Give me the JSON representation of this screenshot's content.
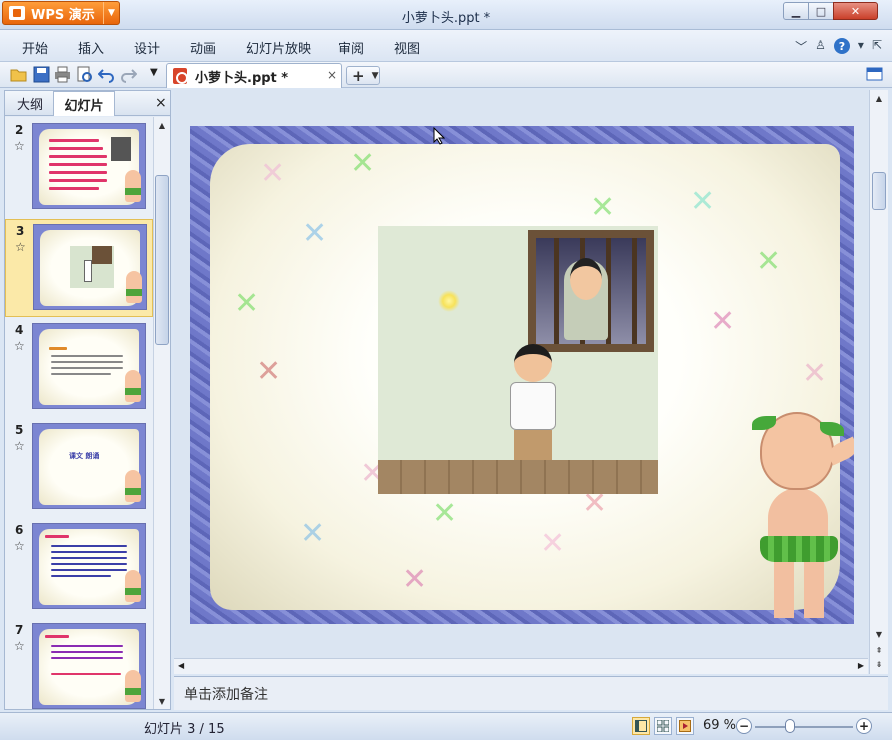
{
  "app": {
    "name": "WPS 演示",
    "title": "小萝卜头.ppt *"
  },
  "window": {
    "min": "▁",
    "max": "□",
    "close": "✕"
  },
  "menu": [
    "开始",
    "插入",
    "设计",
    "动画",
    "幻灯片放映",
    "审阅",
    "视图"
  ],
  "menu_right": {
    "collapse": "﹀",
    "help": "?"
  },
  "toolbar": {
    "doc_tab": "小萝卜头.ppt *",
    "tab_close": "×",
    "new_tab": "+"
  },
  "leftpane": {
    "tabs": [
      "大纲",
      "幻灯片"
    ],
    "close": "×",
    "slides": [
      {
        "num": "2",
        "star": "☆"
      },
      {
        "num": "3",
        "star": "☆"
      },
      {
        "num": "4",
        "star": "☆"
      },
      {
        "num": "5",
        "star": "☆"
      },
      {
        "num": "6",
        "star": "☆"
      },
      {
        "num": "7",
        "star": "☆"
      }
    ],
    "selected_slide": "3",
    "thumb5_text": "课文 朗诵"
  },
  "notes": {
    "placeholder": "单击添加备注"
  },
  "status": {
    "slide_info": "幻灯片 3 / 15",
    "zoom": "69 %",
    "zoom_value": 69
  }
}
